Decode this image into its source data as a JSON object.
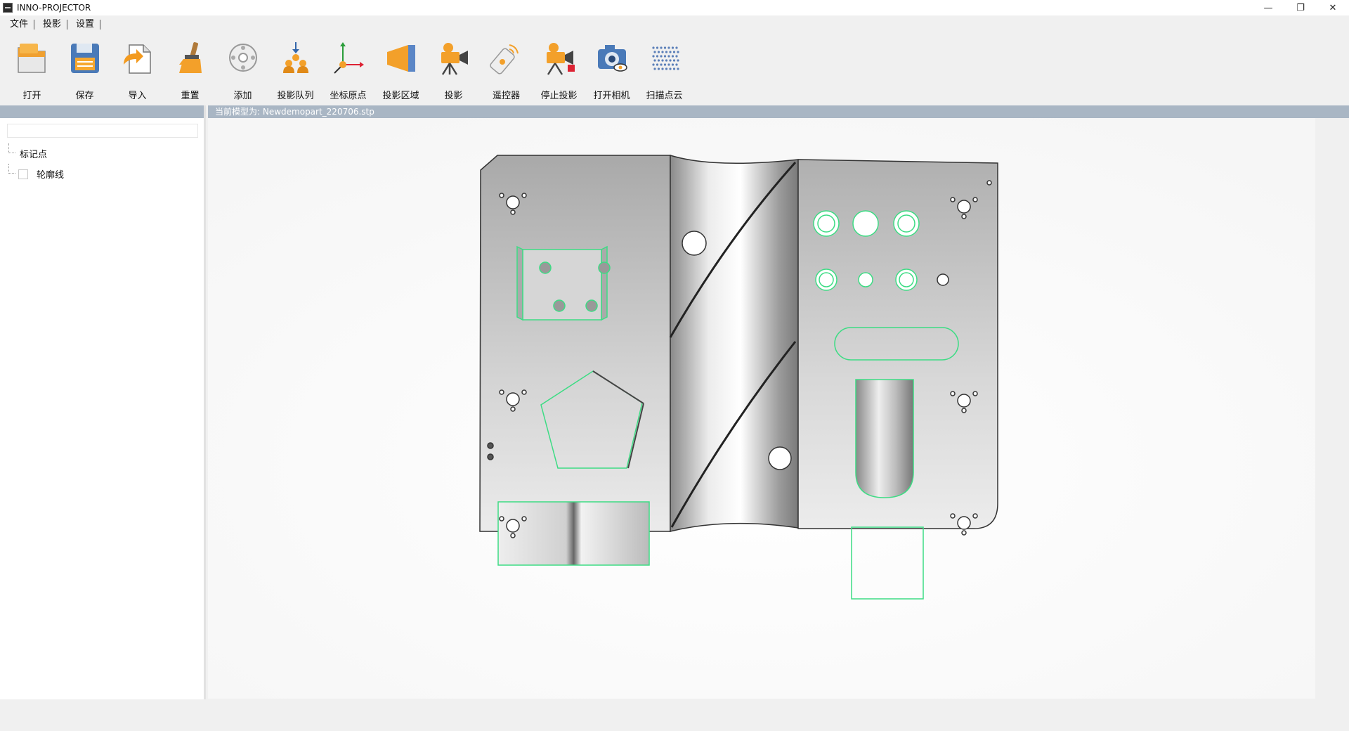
{
  "window": {
    "title": "INNO-PROJECTOR",
    "controls": {
      "minimize": "—",
      "restore": "❐",
      "close": "✕"
    }
  },
  "menu": {
    "items": [
      "文件",
      "投影",
      "设置"
    ]
  },
  "toolbar": {
    "items": [
      {
        "label": "打开",
        "icon": "open-folder-icon"
      },
      {
        "label": "保存",
        "icon": "save-disk-icon"
      },
      {
        "label": "导入",
        "icon": "import-icon"
      },
      {
        "label": "重置",
        "icon": "reset-broom-icon"
      },
      {
        "label": "添加",
        "icon": "add-target-icon"
      },
      {
        "label": "投影队列",
        "icon": "projection-queue-icon"
      },
      {
        "label": "坐标原点",
        "icon": "coordinate-origin-icon"
      },
      {
        "label": "投影区域",
        "icon": "projection-area-icon"
      },
      {
        "label": "投影",
        "icon": "projector-icon"
      },
      {
        "label": "遥控器",
        "icon": "remote-control-icon"
      },
      {
        "label": "停止投影",
        "icon": "stop-projection-icon"
      },
      {
        "label": "打开相机",
        "icon": "camera-icon"
      },
      {
        "label": "扫描点云",
        "icon": "point-cloud-icon"
      }
    ]
  },
  "left_panel": {
    "search_value": "",
    "tree": [
      {
        "label": "标记点",
        "checkbox": false
      },
      {
        "label": "轮廓线",
        "checkbox": true,
        "checked": false
      }
    ]
  },
  "viewport": {
    "model_label": "当前模型为:  Newdemopart_220706.stp",
    "accent_color": "#3ddc84"
  }
}
